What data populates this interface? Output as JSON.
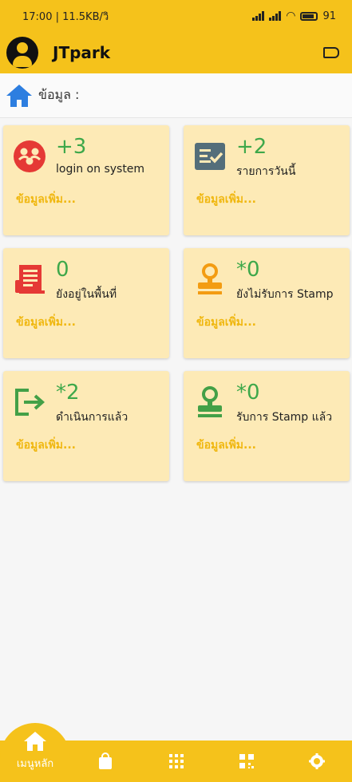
{
  "status": {
    "left": "17:00 | 11.5KB/วิ",
    "battery": "91"
  },
  "app": {
    "title": "JTpark"
  },
  "breadcrumb": {
    "label": "ข้อมูล :"
  },
  "cards": [
    {
      "count": "+3",
      "label": "login on system",
      "more": "ข้อมูลเพิ่ม..."
    },
    {
      "count": "+2",
      "label": "รายการวันนี้",
      "more": "ข้อมูลเพิ่ม..."
    },
    {
      "count": "0",
      "label": "ยังอยู่ในพื้นที่",
      "more": "ข้อมูลเพิ่ม..."
    },
    {
      "count": "*0",
      "label": "ยังไม่รับการ Stamp",
      "more": "ข้อมูลเพิ่ม..."
    },
    {
      "count": "*2",
      "label": "ดำเนินการแล้ว",
      "more": "ข้อมูลเพิ่ม..."
    },
    {
      "count": "*0",
      "label": "รับการ Stamp แล้ว",
      "more": "ข้อมูลเพิ่ม..."
    }
  ],
  "bottom_nav": {
    "home_label": "เมนูหลัก"
  },
  "icons": [
    "home-icon",
    "users-icon",
    "checklist-icon",
    "receipt-icon",
    "stamp-icon",
    "exit-icon",
    "shopping-bag-icon",
    "apps-grid-icon",
    "qr-code-icon",
    "settings-icon",
    "logout-icon"
  ],
  "colors": {
    "brand": "#f5c21b",
    "card": "#fdeab6",
    "count": "#3ea84a",
    "more": "#f0b70f"
  }
}
